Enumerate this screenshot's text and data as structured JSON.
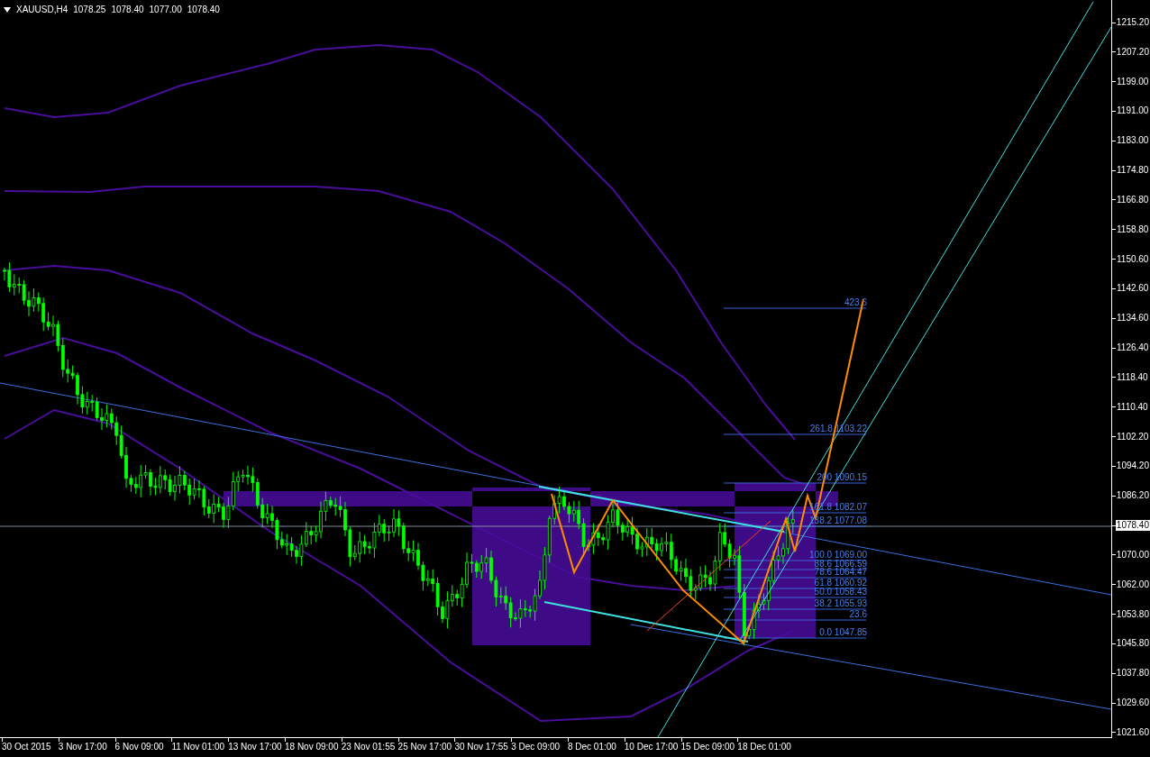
{
  "chart": {
    "symbol": "XAUUSD,H4",
    "ohlc": [
      "1078.25",
      "1078.40",
      "1077.00",
      "1078.40"
    ]
  },
  "fib_levels": [
    {
      "label": "423.6"
    },
    {
      "label": "261.8 1103.22"
    },
    {
      "label": "200 1090.15"
    },
    {
      "label": "161.8 1082.07"
    },
    {
      "label": "138.2 1077.08"
    },
    {
      "label": "100.0 1069.00"
    },
    {
      "label": "88.6 1066.59"
    },
    {
      "label": "78.6 1064.47"
    },
    {
      "label": "61.8 1060.92"
    },
    {
      "label": "50.0 1058.43"
    },
    {
      "label": "38.2 1055.93"
    },
    {
      "label": "23.6"
    },
    {
      "label": "0.0 1047.85"
    }
  ],
  "price_axis": [
    {
      "text": "1215.20",
      "current": false
    },
    {
      "text": "1207.20",
      "current": false
    },
    {
      "text": "1199.00",
      "current": false
    },
    {
      "text": "1191.00",
      "current": false
    },
    {
      "text": "1183.00",
      "current": false
    },
    {
      "text": "1174.80",
      "current": false
    },
    {
      "text": "1166.80",
      "current": false
    },
    {
      "text": "1158.80",
      "current": false
    },
    {
      "text": "1150.60",
      "current": false
    },
    {
      "text": "1142.60",
      "current": false
    },
    {
      "text": "1134.60",
      "current": false
    },
    {
      "text": "1126.40",
      "current": false
    },
    {
      "text": "1118.40",
      "current": false
    },
    {
      "text": "1110.40",
      "current": false
    },
    {
      "text": "1102.20",
      "current": false
    },
    {
      "text": "1094.20",
      "current": false
    },
    {
      "text": "1086.20",
      "current": false
    },
    {
      "text": "1078.40",
      "current": true
    },
    {
      "text": "1070.00",
      "current": false
    },
    {
      "text": "1062.00",
      "current": false
    },
    {
      "text": "1053.80",
      "current": false
    },
    {
      "text": "1045.80",
      "current": false
    },
    {
      "text": "1037.80",
      "current": false
    },
    {
      "text": "1029.60",
      "current": false
    },
    {
      "text": "1021.60",
      "current": false
    }
  ],
  "time_axis": [
    "30 Oct 2015",
    "3 Nov 17:00",
    "6 Nov 09:00",
    "11 Nov 01:00",
    "13 Nov 17:00",
    "18 Nov 09:00",
    "23 Nov 01:55",
    "25 Nov 17:00",
    "30 Nov 17:55",
    "3 Dec 09:00",
    "8 Dec 01:00",
    "10 Dec 17:00",
    "15 Dec 09:00",
    "18 Dec 01:00"
  ]
}
